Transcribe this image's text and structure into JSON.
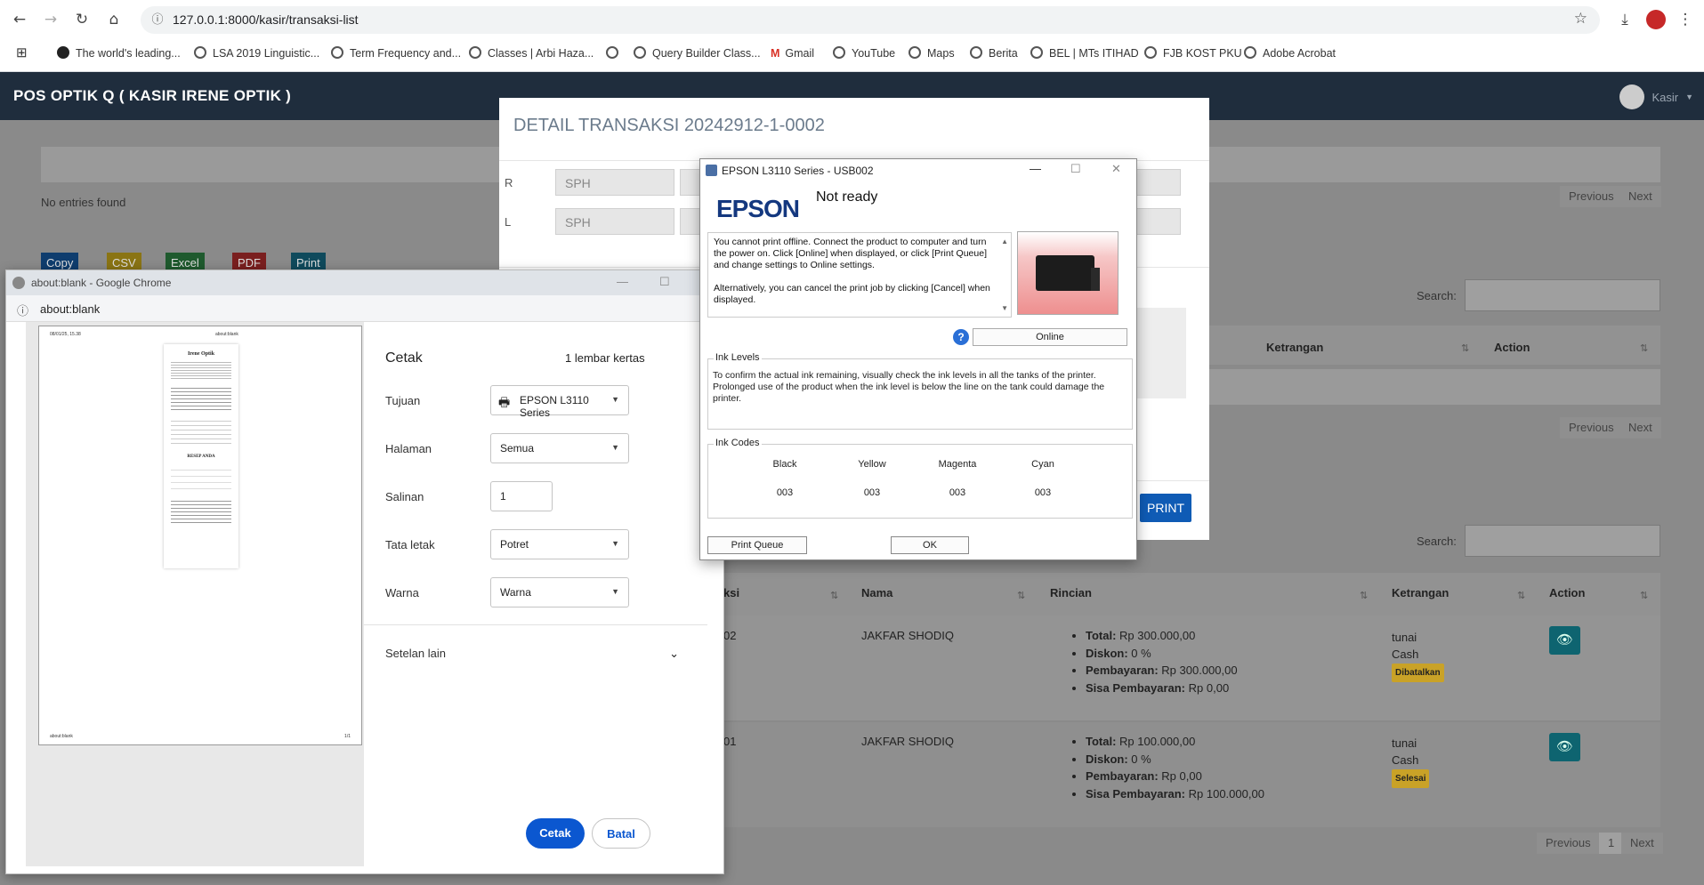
{
  "browser": {
    "url": "127.0.0.1:8000/kasir/transaksi-list",
    "bookmarks": [
      "The world's leading...",
      "LSA 2019 Linguistic...",
      "Term Frequency and...",
      "Classes | Arbi Haza...",
      "",
      "Query Builder Class...",
      "Gmail",
      "YouTube",
      "Maps",
      "Berita",
      "BEL | MTs ITIHAD",
      "FJB KOST PKU",
      "Adobe Acrobat"
    ]
  },
  "app": {
    "title": "POS OPTIK Q ( KASIR IRENE OPTIK )",
    "user": "Kasir",
    "no_entries": "No entries found",
    "export_buttons": [
      "Copy",
      "CSV",
      "Excel",
      "PDF",
      "Print"
    ],
    "search_label": "Search:",
    "pager": {
      "previous": "Previous",
      "next": "Next",
      "page": "1"
    },
    "mid_table_headers": [
      "Ketrangan",
      "Action"
    ],
    "table_headers": [
      "ksi",
      "Nama",
      "Rincian",
      "Ketrangan",
      "Action"
    ],
    "rows": [
      {
        "id_fragment": "02",
        "nama": "JAKFAR SHODIQ",
        "rincian": [
          [
            "Total:",
            "Rp 300.000,00"
          ],
          [
            "Diskon:",
            "0 %"
          ],
          [
            "Pembayaran:",
            "Rp 300.000,00"
          ],
          [
            "Sisa Pembayaran:",
            "Rp 0,00"
          ]
        ],
        "ket1": "tunai",
        "ket2": "Cash",
        "status": "Dibatalkan"
      },
      {
        "id_fragment": "01",
        "nama": "JAKFAR SHODIQ",
        "rincian": [
          [
            "Total:",
            "Rp 100.000,00"
          ],
          [
            "Diskon:",
            "0 %"
          ],
          [
            "Pembayaran:",
            "Rp 0,00"
          ],
          [
            "Sisa Pembayaran:",
            "Rp 100.000,00"
          ]
        ],
        "ket1": "tunai",
        "ket2": "Cash",
        "status": "Selesai"
      }
    ]
  },
  "detail": {
    "title": "DETAIL TRANSAKSI 20242912-1-0002",
    "row_r": "R",
    "row_l": "L",
    "sph": "SPH",
    "print_button": "PRINT"
  },
  "about_window": {
    "title": "about:blank - Google Chrome",
    "url": "about:blank",
    "preview": {
      "date": "08/01/25, 15.38",
      "doc_title": "about:blank",
      "shop": "Irene Optik",
      "resep": "RESEP ANDA",
      "footer_left": "about:blank",
      "footer_right": "1/1"
    },
    "print": {
      "heading": "Cetak",
      "sheets": "1 lembar kertas",
      "tujuan_label": "Tujuan",
      "tujuan_value": "EPSON L3110 Series",
      "halaman_label": "Halaman",
      "halaman_value": "Semua",
      "salinan_label": "Salinan",
      "salinan_value": "1",
      "tata_label": "Tata letak",
      "tata_value": "Potret",
      "warna_label": "Warna",
      "warna_value": "Warna",
      "setelan": "Setelan lain",
      "cetak_btn": "Cetak",
      "batal_btn": "Batal"
    }
  },
  "epson": {
    "title": "EPSON L3110 Series - USB002",
    "logo": "EPSON",
    "status": "Not ready",
    "msg1": "You cannot print offline. Connect the product to computer and turn the power on. Click [Online] when displayed, or click [Print Queue] and change settings to Online settings.",
    "msg2": "Alternatively, you can cancel the print job by clicking [Cancel] when displayed.",
    "online": "Online",
    "ink_levels_label": "Ink Levels",
    "ink_levels_text": "To confirm the actual ink remaining, visually check the ink levels in all the tanks of the printer. Prolonged use of the product when the ink level is below the line on the tank could damage the printer.",
    "ink_codes_label": "Ink Codes",
    "inks": [
      {
        "name": "Black",
        "code": "003"
      },
      {
        "name": "Yellow",
        "code": "003"
      },
      {
        "name": "Magenta",
        "code": "003"
      },
      {
        "name": "Cyan",
        "code": "003"
      }
    ],
    "print_queue": "Print Queue",
    "ok": "OK"
  },
  "colors": {
    "app_header": "#1f2d3d",
    "primary": "#0b57d0",
    "eye_button": "#0e6470",
    "badge": "#c9a227"
  }
}
